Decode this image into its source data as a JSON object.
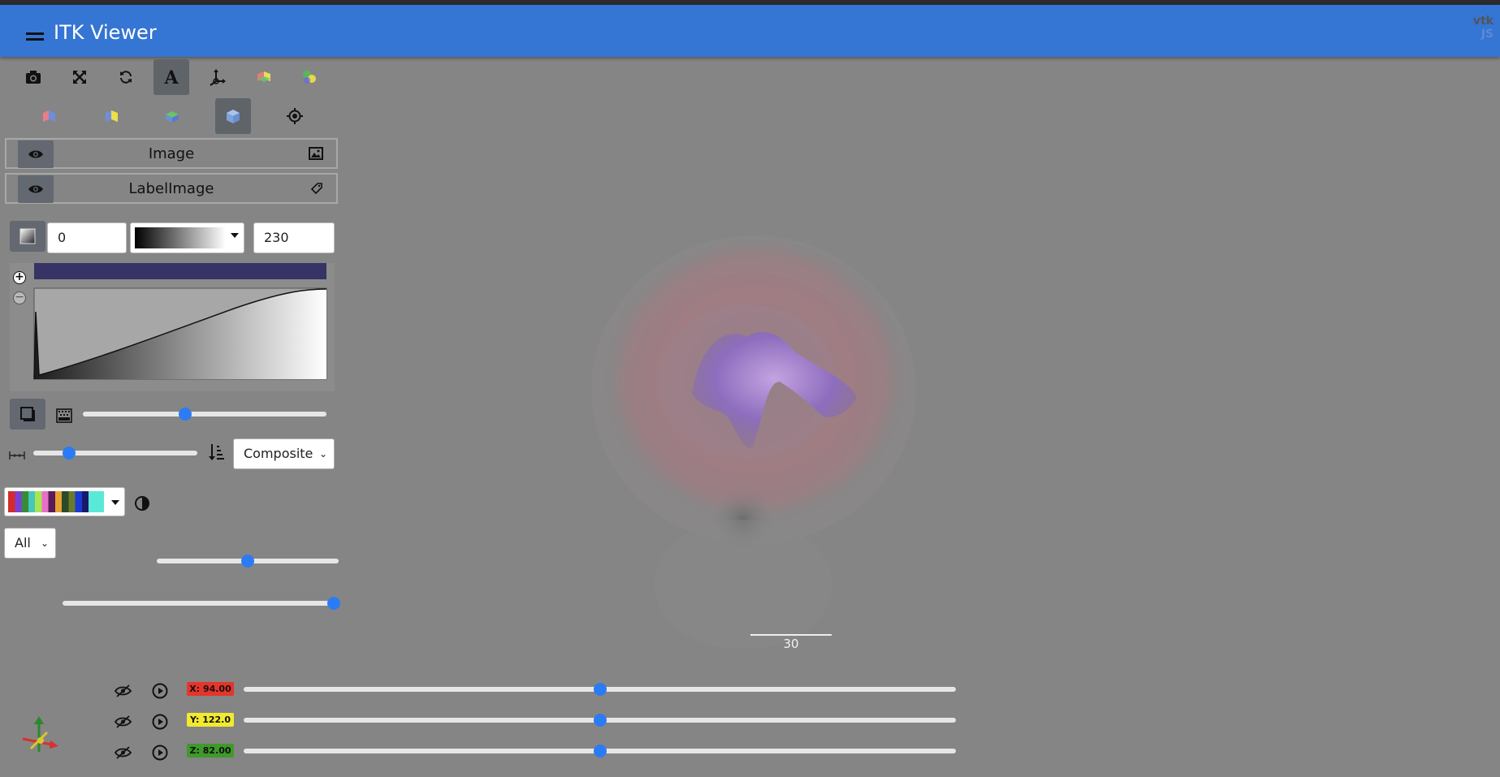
{
  "app": {
    "title": "ITK Viewer",
    "logo_top": "vtk",
    "logo_bottom": "JS"
  },
  "toolbar": {
    "row1": [
      "camera-icon",
      "fullscreen-icon",
      "rotate-icon",
      "annotations-icon",
      "axes-icon",
      "view-planes-icon",
      "blend-icon"
    ],
    "row2": [
      "x-plane-icon",
      "y-plane-icon",
      "z-plane-icon",
      "volume-icon",
      "reset-camera-icon"
    ],
    "active": [
      "annotations-icon",
      "volume-icon"
    ]
  },
  "layers": [
    {
      "name": "Image",
      "type_icon": "image-icon"
    },
    {
      "name": "LabelImage",
      "type_icon": "label-tag-icon"
    }
  ],
  "color_range": {
    "min": "0",
    "max": "230",
    "colormap": "Grayscale"
  },
  "transfer_function": {
    "zoom_in": "+",
    "zoom_out": "−"
  },
  "gradient_opacity": {
    "value": 0.42
  },
  "sample_distance": {
    "value": 0.22
  },
  "blend_mode": {
    "selected": "Composite"
  },
  "label_opacity": {
    "value": 0.5
  },
  "label_select": {
    "selected": "All"
  },
  "label_weight": {
    "value": 1.0
  },
  "scale_bar": {
    "label": "30"
  },
  "slices": [
    {
      "label": "X: 94.00",
      "color": "#e5352b",
      "value": 0.5
    },
    {
      "label": "Y: 122.0",
      "color": "#f2ea2e",
      "value": 0.5
    },
    {
      "label": "Z: 82.00",
      "color": "#3e9a2a",
      "value": 0.5
    }
  ],
  "colors": {
    "appbar": "#3575d3",
    "accent": "#2b7bf4",
    "background": "#858585"
  }
}
